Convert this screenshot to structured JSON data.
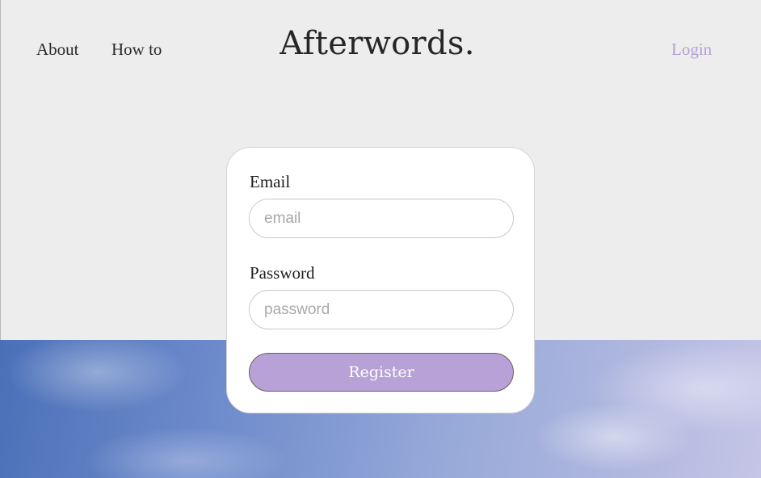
{
  "header": {
    "nav_left": [
      {
        "label": "About"
      },
      {
        "label": "How to"
      }
    ],
    "logo": "Afterwords.",
    "login_label": "Login",
    "login_color": "#b39fd6"
  },
  "form": {
    "email_label": "Email",
    "email_placeholder": "email",
    "email_value": "",
    "password_label": "Password",
    "password_placeholder": "password",
    "password_value": "",
    "register_label": "Register",
    "register_color": "#b7a1d6"
  },
  "background": {
    "top_color": "#ededed",
    "sky_color": "#6f8ccc"
  }
}
